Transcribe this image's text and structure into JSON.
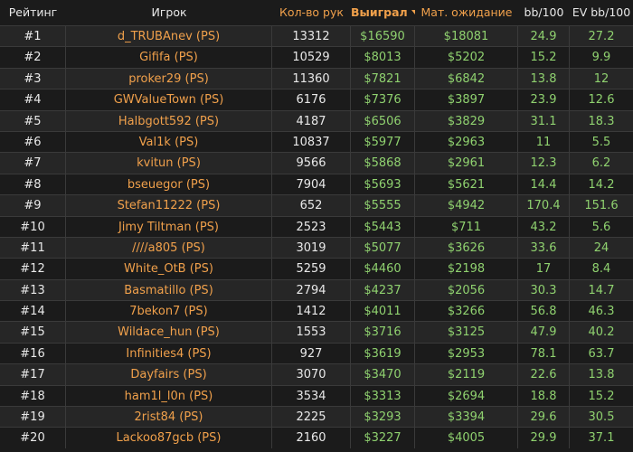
{
  "header": {
    "rank": "Рейтинг",
    "player": "Игрок",
    "hands": "Кол-во рук",
    "won": "Выиграл",
    "ev": "Мат. ожидание",
    "bb100": "bb/100",
    "evbb100": "EV bb/100",
    "sort_icon": "caret-down-icon"
  },
  "rows": [
    {
      "rank": "#1",
      "player": "d_TRUBAnev (PS)",
      "hands": "13312",
      "won": "$16590",
      "ev": "$18081",
      "bb100": "24.9",
      "evbb100": "27.2"
    },
    {
      "rank": "#2",
      "player": "Gififa (PS)",
      "hands": "10529",
      "won": "$8013",
      "ev": "$5202",
      "bb100": "15.2",
      "evbb100": "9.9"
    },
    {
      "rank": "#3",
      "player": "proker29 (PS)",
      "hands": "11360",
      "won": "$7821",
      "ev": "$6842",
      "bb100": "13.8",
      "evbb100": "12"
    },
    {
      "rank": "#4",
      "player": "GWValueTown (PS)",
      "hands": "6176",
      "won": "$7376",
      "ev": "$3897",
      "bb100": "23.9",
      "evbb100": "12.6"
    },
    {
      "rank": "#5",
      "player": "Halbgott592 (PS)",
      "hands": "4187",
      "won": "$6506",
      "ev": "$3829",
      "bb100": "31.1",
      "evbb100": "18.3"
    },
    {
      "rank": "#6",
      "player": "Val1k (PS)",
      "hands": "10837",
      "won": "$5977",
      "ev": "$2963",
      "bb100": "11",
      "evbb100": "5.5"
    },
    {
      "rank": "#7",
      "player": "kvitun (PS)",
      "hands": "9566",
      "won": "$5868",
      "ev": "$2961",
      "bb100": "12.3",
      "evbb100": "6.2"
    },
    {
      "rank": "#8",
      "player": "bseuegor (PS)",
      "hands": "7904",
      "won": "$5693",
      "ev": "$5621",
      "bb100": "14.4",
      "evbb100": "14.2"
    },
    {
      "rank": "#9",
      "player": "Stefan11222 (PS)",
      "hands": "652",
      "won": "$5555",
      "ev": "$4942",
      "bb100": "170.4",
      "evbb100": "151.6"
    },
    {
      "rank": "#10",
      "player": "Jimy Tiltman (PS)",
      "hands": "2523",
      "won": "$5443",
      "ev": "$711",
      "bb100": "43.2",
      "evbb100": "5.6"
    },
    {
      "rank": "#11",
      "player": "////a805 (PS)",
      "hands": "3019",
      "won": "$5077",
      "ev": "$3626",
      "bb100": "33.6",
      "evbb100": "24"
    },
    {
      "rank": "#12",
      "player": "White_OtB (PS)",
      "hands": "5259",
      "won": "$4460",
      "ev": "$2198",
      "bb100": "17",
      "evbb100": "8.4"
    },
    {
      "rank": "#13",
      "player": "Basmatillo (PS)",
      "hands": "2794",
      "won": "$4237",
      "ev": "$2056",
      "bb100": "30.3",
      "evbb100": "14.7"
    },
    {
      "rank": "#14",
      "player": "7bekon7 (PS)",
      "hands": "1412",
      "won": "$4011",
      "ev": "$3266",
      "bb100": "56.8",
      "evbb100": "46.3"
    },
    {
      "rank": "#15",
      "player": "Wildace_hun (PS)",
      "hands": "1553",
      "won": "$3716",
      "ev": "$3125",
      "bb100": "47.9",
      "evbb100": "40.2"
    },
    {
      "rank": "#16",
      "player": "Infinities4 (PS)",
      "hands": "927",
      "won": "$3619",
      "ev": "$2953",
      "bb100": "78.1",
      "evbb100": "63.7"
    },
    {
      "rank": "#17",
      "player": "Dayfairs (PS)",
      "hands": "3070",
      "won": "$3470",
      "ev": "$2119",
      "bb100": "22.6",
      "evbb100": "13.8"
    },
    {
      "rank": "#18",
      "player": "ham1l_l0n (PS)",
      "hands": "3534",
      "won": "$3313",
      "ev": "$2694",
      "bb100": "18.8",
      "evbb100": "15.2"
    },
    {
      "rank": "#19",
      "player": "2rist84 (PS)",
      "hands": "2225",
      "won": "$3293",
      "ev": "$3394",
      "bb100": "29.6",
      "evbb100": "30.5"
    },
    {
      "rank": "#20",
      "player": "Lackoo87gcb (PS)",
      "hands": "2160",
      "won": "$3227",
      "ev": "$4005",
      "bb100": "29.9",
      "evbb100": "37.1"
    }
  ]
}
